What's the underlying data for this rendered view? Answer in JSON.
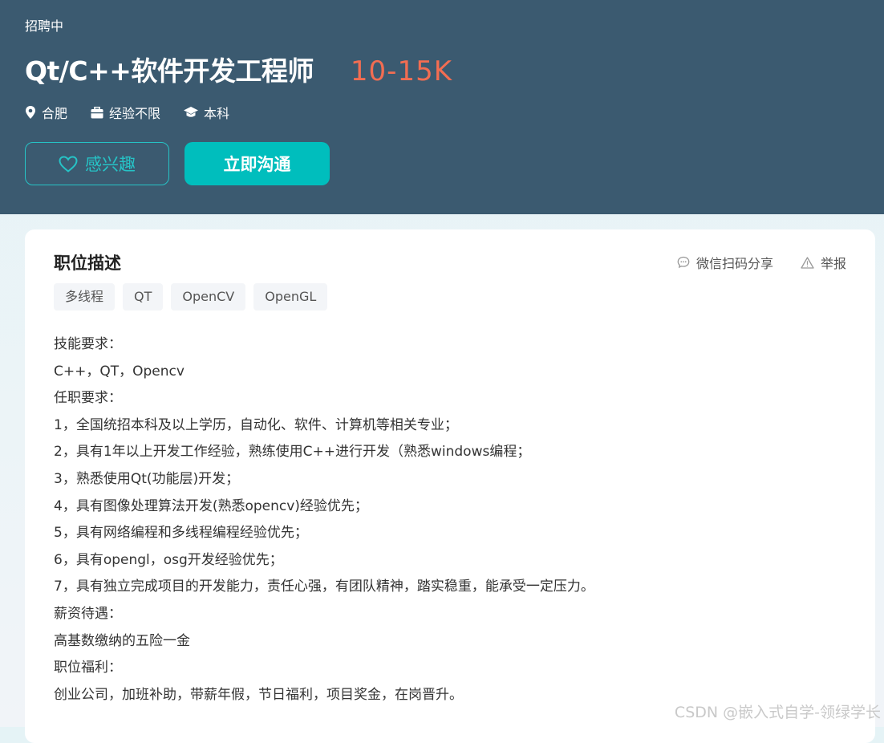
{
  "header": {
    "status": "招聘中",
    "job_title": "Qt/C++软件开发工程师",
    "salary": "10-15K",
    "location": "合肥",
    "experience": "经验不限",
    "education": "本科",
    "interest_label": "感兴趣",
    "chat_label": "立即沟通"
  },
  "colors": {
    "header_bg": "#3b5a70",
    "salary": "#f26d52",
    "accent": "#00bebd"
  },
  "main": {
    "section_title": "职位描述",
    "share_label": "微信扫码分享",
    "report_label": "举报",
    "tags": [
      "多线程",
      "QT",
      "OpenCV",
      "OpenGL"
    ],
    "description": [
      "技能要求：",
      "C++，QT，Opencv",
      "任职要求：",
      "1，全国统招本科及以上学历，自动化、软件、计算机等相关专业；",
      "2，具有1年以上开发工作经验，熟练使用C++进行开发（熟悉windows编程；",
      "3，熟悉使用Qt(功能层)开发；",
      "4，具有图像处理算法开发(熟悉opencv)经验优先；",
      "5，具有网络编程和多线程编程经验优先；",
      "6，具有opengl，osg开发经验优先；",
      "7，具有独立完成项目的开发能力，责任心强，有团队精神，踏实稳重，能承受一定压力。",
      "薪资待遇：",
      "高基数缴纳的五险一金",
      "职位福利：",
      "创业公司，加班补助，带薪年假，节日福利，项目奖金，在岗晋升。"
    ]
  },
  "icons": {
    "location": "location-pin-icon",
    "experience": "briefcase-icon",
    "education": "graduation-cap-icon",
    "interest": "heart-icon",
    "share": "chat-bubble-icon",
    "report": "warning-triangle-icon"
  },
  "watermark": "CSDN @嵌入式自学-领绿学长"
}
